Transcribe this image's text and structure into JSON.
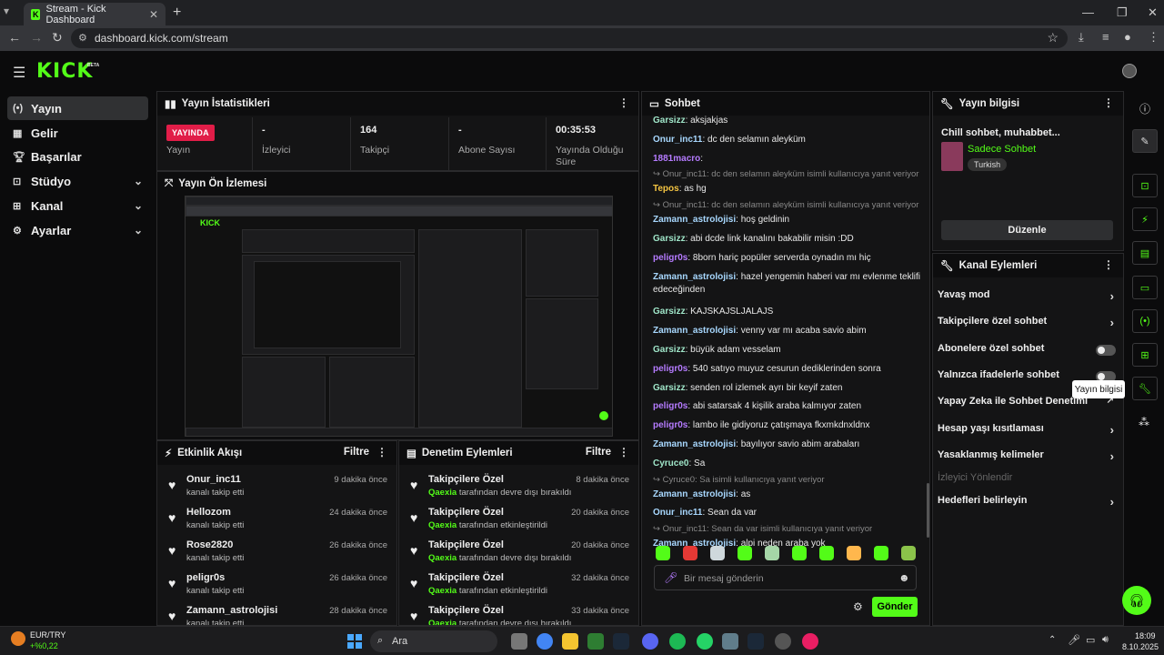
{
  "browser": {
    "tab_title": "Stream - Kick Dashboard",
    "url": "dashboard.kick.com/stream"
  },
  "app": {
    "logo": "KICK",
    "logo_badge": "BETA"
  },
  "sidebar": {
    "items": [
      {
        "label": "Yayın",
        "icon": "broadcast-icon",
        "active": true,
        "chevron": false
      },
      {
        "label": "Gelir",
        "icon": "revenue-icon",
        "active": false,
        "chevron": false
      },
      {
        "label": "Başarılar",
        "icon": "trophy-icon",
        "active": false,
        "chevron": false
      },
      {
        "label": "Stüdyo",
        "icon": "studio-icon",
        "active": false,
        "chevron": true
      },
      {
        "label": "Kanal",
        "icon": "channel-icon",
        "active": false,
        "chevron": true
      },
      {
        "label": "Ayarlar",
        "icon": "gear-icon",
        "active": false,
        "chevron": true
      }
    ]
  },
  "stats": {
    "title": "Yayın İstatistikleri",
    "live_badge": "YAYINDA",
    "live_label": "Yayın",
    "viewers_value": "-",
    "viewers_label": "İzleyici",
    "followers_value": "164",
    "followers_label": "Takipçi",
    "subs_value": "-",
    "subs_label": "Abone Sayısı",
    "uptime_value": "00:35:53",
    "uptime_label": "Yayında Olduğu Süre"
  },
  "preview": {
    "title": "Yayın Ön İzlemesi"
  },
  "activity": {
    "title": "Etkinlik Akışı",
    "filter": "Filtre",
    "rows": [
      {
        "name": "Onur_inc11",
        "sub": "kanalı takip etti",
        "time": "9 dakika önce"
      },
      {
        "name": "Hellozom",
        "sub": "kanalı takip etti",
        "time": "24 dakika önce"
      },
      {
        "name": "Rose2820",
        "sub": "kanalı takip etti",
        "time": "26 dakika önce"
      },
      {
        "name": "peligr0s",
        "sub": "kanalı takip etti",
        "time": "26 dakika önce"
      },
      {
        "name": "Zamann_astrolojisi",
        "sub": "kanalı takip etti",
        "time": "28 dakika önce"
      }
    ]
  },
  "moderation": {
    "title": "Denetim Eylemleri",
    "filter": "Filtre",
    "rows": [
      {
        "name": "Takipçilere Özel",
        "actor": "Qaexia",
        "sub": "tarafından devre dışı bırakıldı",
        "time": "8 dakika önce"
      },
      {
        "name": "Takipçilere Özel",
        "actor": "Qaexia",
        "sub": "tarafından etkinleştirildi",
        "time": "20 dakika önce"
      },
      {
        "name": "Takipçilere Özel",
        "actor": "Qaexia",
        "sub": "tarafından devre dışı bırakıldı",
        "time": "20 dakika önce"
      },
      {
        "name": "Takipçilere Özel",
        "actor": "Qaexia",
        "sub": "tarafından etkinleştirildi",
        "time": "32 dakika önce"
      },
      {
        "name": "Takipçilere Özel",
        "actor": "Qaexia",
        "sub": "tarafından devre dışı bırakıldı",
        "time": "33 dakika önce"
      }
    ]
  },
  "chat": {
    "title": "Sohbet",
    "messages": [
      {
        "type": "msg",
        "user": "Garsizz",
        "color": "#9fe5c8",
        "text": "aksjakjas"
      },
      {
        "type": "msg",
        "user": "Onur_inc11",
        "color": "#a8d8ff",
        "text": "dc den selamın aleyküm"
      },
      {
        "type": "msg",
        "user": "1881macro",
        "color": "#b57bff",
        "text": ""
      },
      {
        "type": "reply",
        "text": "Onur_inc11: dc den selamın aleyküm isimli kullanıcıya yanıt veriyor"
      },
      {
        "type": "msg",
        "user": "Tepos",
        "color": "#f5c542",
        "text": "as hg"
      },
      {
        "type": "reply",
        "text": "Onur_inc11: dc den selamın aleyküm isimli kullanıcıya yanıt veriyor"
      },
      {
        "type": "msg",
        "user": "Zamann_astrolojisi",
        "color": "#a8d8ff",
        "text": "hoş geldinin"
      },
      {
        "type": "msg",
        "user": "Garsizz",
        "color": "#9fe5c8",
        "text": "abi dcde link kanalını bakabilir misin :DD"
      },
      {
        "type": "msg",
        "user": "peligr0s",
        "color": "#b57bff",
        "text": "8born hariç popüler serverda oynadın mı hiç"
      },
      {
        "type": "msg",
        "user": "Zamann_astrolojisi",
        "color": "#a8d8ff",
        "text": "hazel yengemin haberi var mı evlenme teklifi"
      },
      {
        "type": "cont",
        "text": "edeceğinden"
      },
      {
        "type": "msg",
        "user": "Garsizz",
        "color": "#9fe5c8",
        "text": "KAJSKAJSLJALAJS"
      },
      {
        "type": "msg",
        "user": "Zamann_astrolojisi",
        "color": "#a8d8ff",
        "text": "venny var mı acaba savio abim"
      },
      {
        "type": "msg",
        "user": "Garsizz",
        "color": "#9fe5c8",
        "text": "büyük adam vesselam"
      },
      {
        "type": "msg",
        "user": "peligr0s",
        "color": "#b57bff",
        "text": "540 satıyo muyuz cesurun dediklerinden sonra"
      },
      {
        "type": "msg",
        "user": "Garsizz",
        "color": "#9fe5c8",
        "text": "senden rol izlemek ayrı bir keyif zaten"
      },
      {
        "type": "msg",
        "user": "peligr0s",
        "color": "#b57bff",
        "text": "abi satarsak 4 kişilik araba kalmıyor zaten"
      },
      {
        "type": "msg",
        "user": "peligr0s",
        "color": "#b57bff",
        "text": "lambo ile gidiyoruz çatışmaya fkxmkdnxldnx"
      },
      {
        "type": "msg",
        "user": "Zamann_astrolojisi",
        "color": "#a8d8ff",
        "text": "bayılıyor savio abim arabaları"
      },
      {
        "type": "msg",
        "user": "Cyruce0",
        "color": "#9fe5c8",
        "text": "Sa"
      },
      {
        "type": "reply",
        "text": "Cyruce0: Sa isimli kullanıcıya yanıt veriyor"
      },
      {
        "type": "msg",
        "user": "Zamann_astrolojisi",
        "color": "#a8d8ff",
        "text": "as"
      },
      {
        "type": "msg",
        "user": "Onur_inc11",
        "color": "#a8d8ff",
        "text": "Sean da var"
      },
      {
        "type": "reply",
        "text": "Onur_inc11: Sean da var isimli kullanıcıya yanıt veriyor"
      },
      {
        "type": "msg",
        "user": "Zamann_astrolojisi",
        "color": "#a8d8ff",
        "text": "alpi neden araba yok"
      }
    ],
    "input_placeholder": "Bir mesaj gönderin",
    "send_label": "Gönder"
  },
  "stream_info": {
    "title": "Yayın bilgisi",
    "stream_title": "Chill sohbet, muhabbet...",
    "category": "Sadece Sohbet",
    "tag": "Turkish",
    "edit_label": "Düzenle"
  },
  "channel_actions": {
    "title": "Kanal Eylemleri",
    "items": [
      {
        "label": "Yavaş mod",
        "kind": "chevron",
        "disabled": false
      },
      {
        "label": "Takipçilere özel sohbet",
        "kind": "chevron",
        "disabled": false
      },
      {
        "label": "Abonelere özel sohbet",
        "kind": "toggle",
        "disabled": false
      },
      {
        "label": "Yalnızca ifadelerle sohbet",
        "kind": "toggle",
        "disabled": false
      },
      {
        "label": "Yapay Zeka ile Sohbet Denetimi",
        "kind": "external",
        "disabled": false
      },
      {
        "label": "Hesap yaşı kısıtlaması",
        "kind": "chevron",
        "disabled": false
      },
      {
        "label": "Yasaklanmış kelimeler",
        "kind": "chevron",
        "disabled": false
      },
      {
        "label": "İzleyici Yönlendir",
        "kind": "none",
        "disabled": true
      },
      {
        "label": "Hedefleri belirleyin",
        "kind": "chevron",
        "disabled": false
      }
    ]
  },
  "rail": {
    "tooltip": "Yayın bilgisi"
  },
  "taskbar": {
    "ticker": "EUR/TRY",
    "ticker_change": "+%0,22",
    "search_placeholder": "Ara",
    "time": "18:09",
    "date": "8.10.2025"
  },
  "colors": {
    "accent": "#53fc18",
    "live": "#e11d48"
  }
}
